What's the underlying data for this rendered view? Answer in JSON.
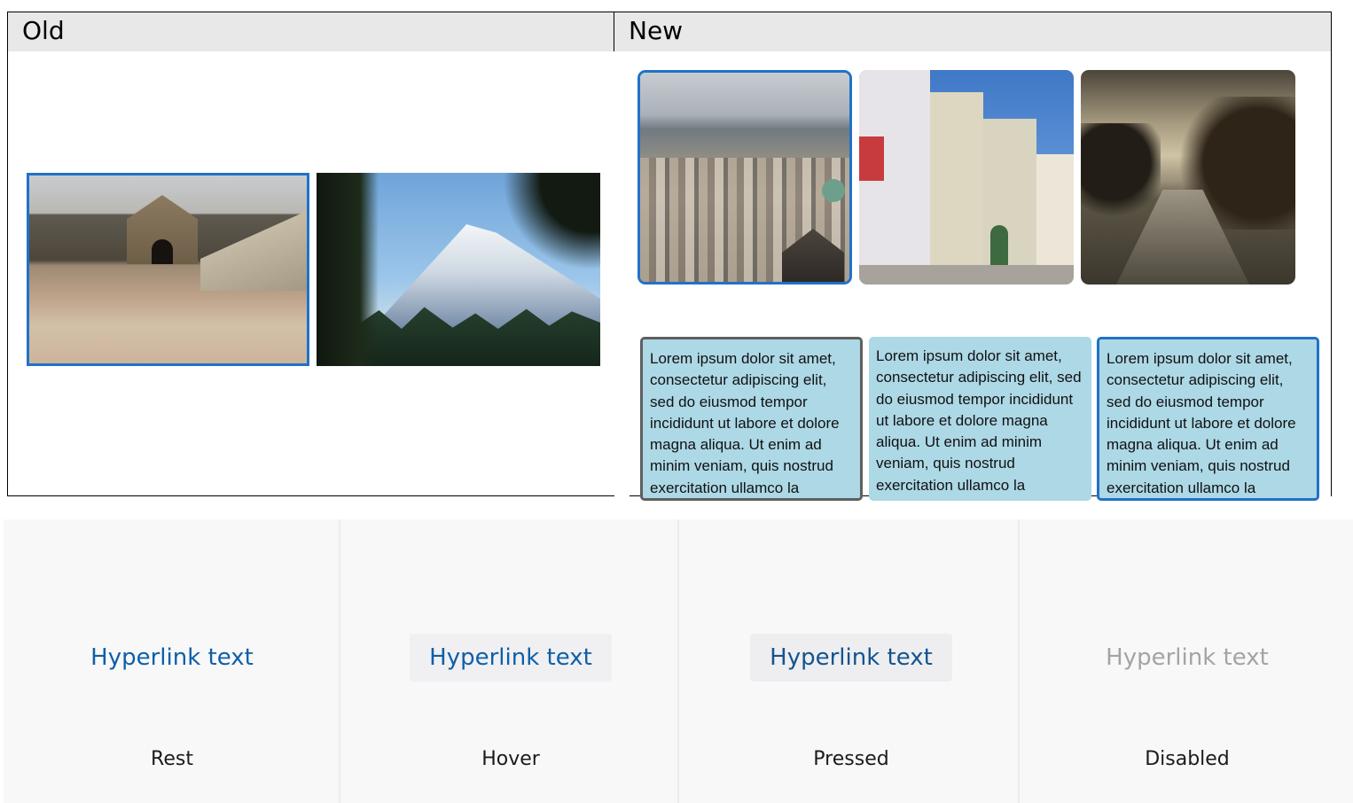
{
  "table": {
    "old_header": "Old",
    "new_header": "New"
  },
  "old_images": [
    {
      "name": "fortress",
      "selected": true
    },
    {
      "name": "mountain",
      "selected": false
    }
  ],
  "new_images": [
    {
      "name": "city",
      "selected": true
    },
    {
      "name": "street",
      "selected": false
    },
    {
      "name": "river",
      "selected": false
    }
  ],
  "cards": [
    {
      "text": "Lorem ipsum dolor sit amet, consectetur adipiscing elit, sed do eiusmod tempor incididunt ut labore et dolore magna aliqua. Ut enim ad minim veniam, quis nostrud exercitation ullamco la",
      "state": "gray-border"
    },
    {
      "text": "Lorem ipsum dolor sit amet, consectetur adipiscing elit, sed do eiusmod tempor incididunt ut labore et dolore magna aliqua. Ut enim ad minim veniam, quis nostrud exercitation ullamco la",
      "state": "none"
    },
    {
      "text": "Lorem ipsum dolor sit amet, consectetur adipiscing elit, sed do eiusmod tempor incididunt ut labore et dolore magna aliqua. Ut enim ad minim veniam, quis nostrud exercitation ullamco la",
      "state": "blue-border"
    }
  ],
  "states": [
    {
      "link": "Hyperlink text",
      "caption": "Rest"
    },
    {
      "link": "Hyperlink text",
      "caption": "Hover"
    },
    {
      "link": "Hyperlink text",
      "caption": "Pressed"
    },
    {
      "link": "Hyperlink text",
      "caption": "Disabled"
    }
  ],
  "colors": {
    "focus_blue": "#1f72c9",
    "card_bg": "#add8e6",
    "link_blue": "#0f5fa8",
    "link_disabled": "#a4a4a6"
  }
}
